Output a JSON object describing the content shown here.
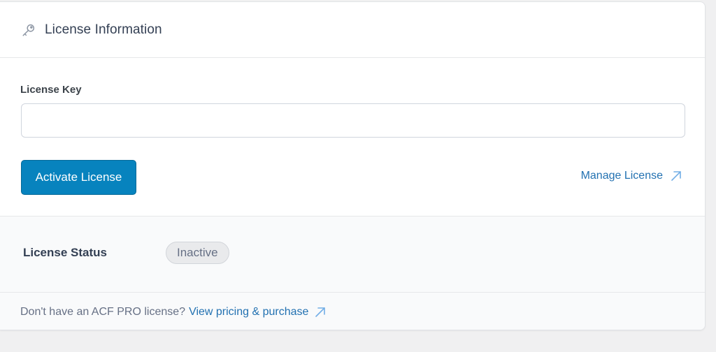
{
  "header": {
    "title": "License Information",
    "icon": "key-icon"
  },
  "license_key": {
    "label": "License Key",
    "value": "",
    "placeholder": ""
  },
  "actions": {
    "activate_label": "Activate License",
    "manage_label": "Manage License",
    "manage_icon": "external-link-icon"
  },
  "status": {
    "label": "License Status",
    "value": "Inactive"
  },
  "footer": {
    "text": "Don't have an ACF PRO license?",
    "link_label": "View pricing & purchase",
    "link_icon": "external-link-icon"
  },
  "colors": {
    "primary_button": "#0783be",
    "link": "#2271b1",
    "page_background": "#f0f0f1"
  }
}
